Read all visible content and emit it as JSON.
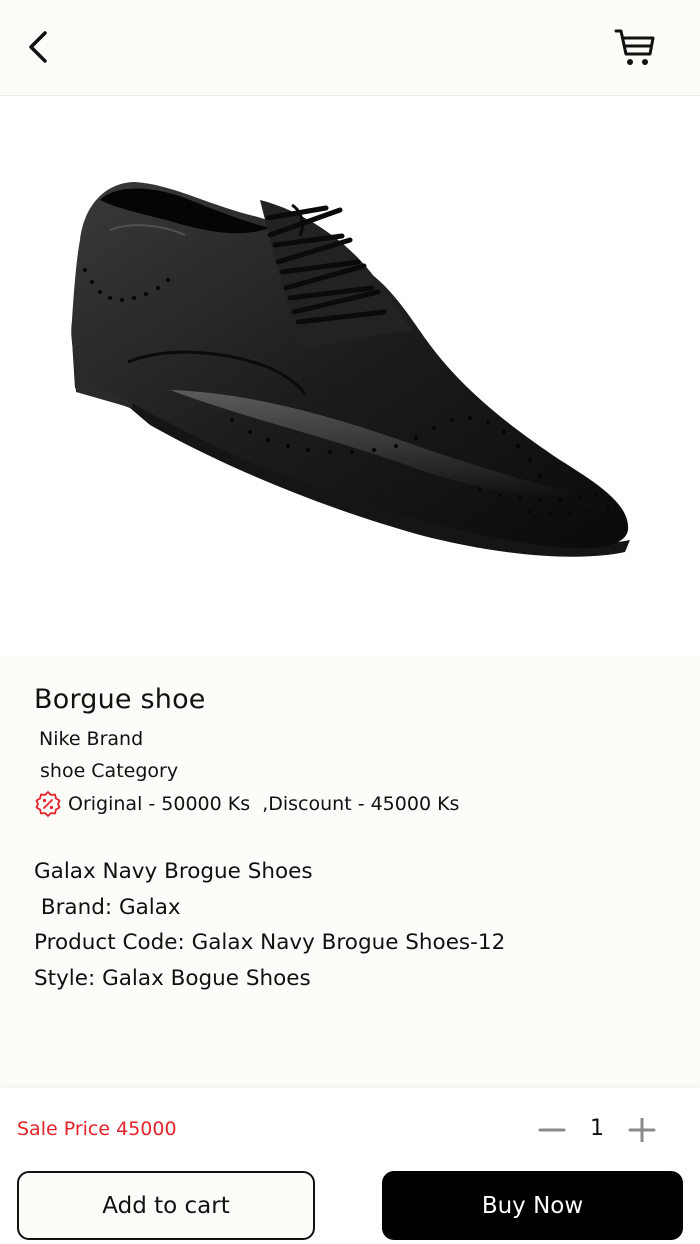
{
  "header": {
    "back_icon": "chevron-left-icon",
    "cart_icon": "shopping-cart-icon"
  },
  "product": {
    "image_icon": "oxford-brogue-shoe-image",
    "title": "Borgue shoe",
    "brand": "Nike Brand",
    "category": "shoe Category",
    "discount_icon": "discount-percent-icon",
    "price_line": "Original - 50000 Ks  ,Discount - 45000 Ks",
    "description": [
      "Galax Navy Brogue Shoes",
      " Brand: Galax",
      "Product Code: Galax Navy Brogue Shoes-12",
      "Style: Galax Bogue Shoes"
    ]
  },
  "footer": {
    "sale_price": "Sale Price 45000",
    "quantity": "1",
    "add_to_cart_label": "Add to cart",
    "buy_now_label": "Buy Now"
  },
  "colors": {
    "sale_price": "#e5232b",
    "discount_icon": "#e5232b",
    "buy_now_bg": "#000000",
    "page_bg": "#fdfcf8"
  }
}
